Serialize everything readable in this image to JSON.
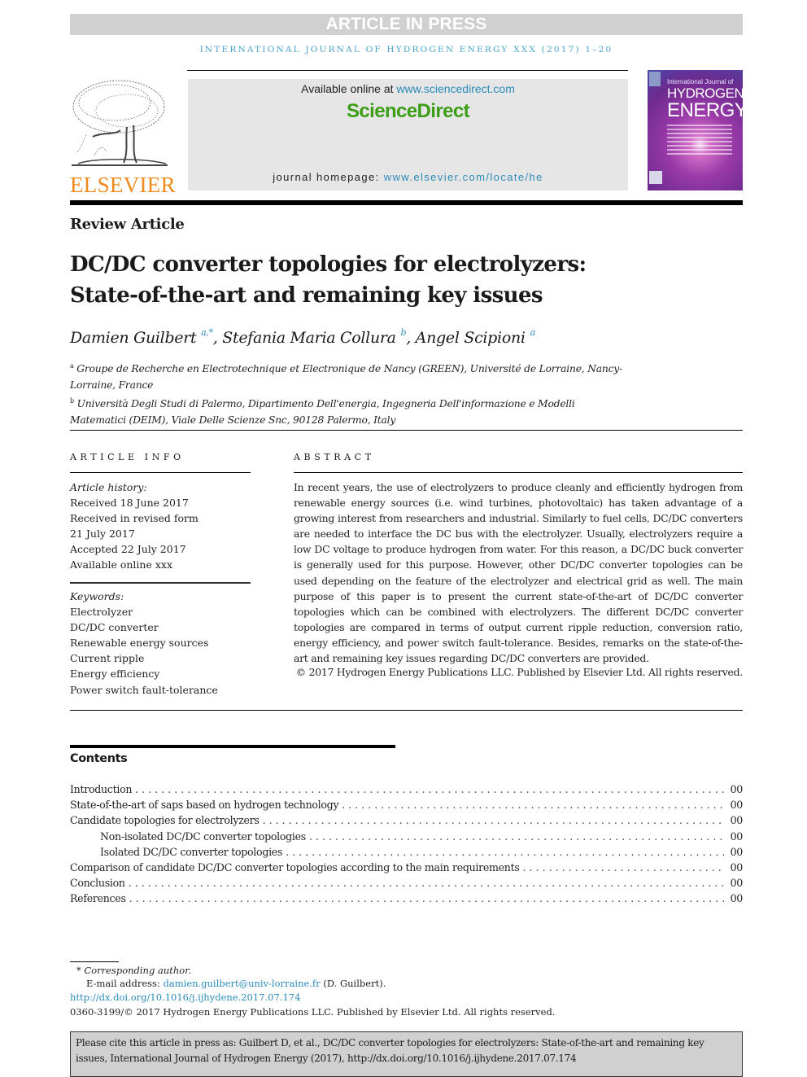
{
  "banner": {
    "text": "ARTICLE IN PRESS"
  },
  "running_header": "INTERNATIONAL JOURNAL OF HYDROGEN ENERGY XXX (2017) 1–20",
  "masthead": {
    "publisher_logo_text": "ELSEVIER",
    "available_online_prefix": "Available online at ",
    "available_online_link": "www.sciencedirect.com",
    "platform_name": "ScienceDirect",
    "homepage_prefix": "journal homepage: ",
    "homepage_link": "www.elsevier.com/locate/he",
    "cover": {
      "line1": "International Journal of",
      "line2": "HYDROGEN",
      "line3": "ENERGY"
    },
    "colors": {
      "elsevier_orange": "#f08a1e",
      "sciencedirect_green": "#3c9d17",
      "link_blue": "#2a8ab8"
    }
  },
  "article": {
    "type": "Review Article",
    "title_line1": "DC/DC converter topologies for electrolyzers:",
    "title_line2": "State-of-the-art and remaining key issues",
    "authors": [
      {
        "name": "Damien Guilbert",
        "sup": "a,*"
      },
      {
        "name": "Stefania Maria Collura",
        "sup": "b"
      },
      {
        "name": "Angel Scipioni",
        "sup": "a"
      }
    ],
    "author_separator": ", ",
    "affiliations": [
      {
        "mark": "a",
        "text": "Groupe de Recherche en Electrotechnique et Electronique de Nancy (GREEN), Université de Lorraine, Nancy-Lorraine, France"
      },
      {
        "mark": "b",
        "text": "Università Degli Studi di Palermo, Dipartimento Dell'energia, Ingegneria Dell'informazione e Modelli Matematici (DEIM), Viale Delle Scienze Snc, 90128 Palermo, Italy"
      }
    ]
  },
  "article_info": {
    "caption": "ARTICLE INFO",
    "history_label": "Article history:",
    "history": [
      "Received 18 June 2017",
      "Received in revised form",
      "21 July 2017",
      "Accepted 22 July 2017",
      "Available online xxx"
    ],
    "keywords_label": "Keywords:",
    "keywords": [
      "Electrolyzer",
      "DC/DC converter",
      "Renewable energy sources",
      "Current ripple",
      "Energy efficiency",
      "Power switch fault-tolerance"
    ]
  },
  "abstract": {
    "caption": "ABSTRACT",
    "text": "In recent years, the use of electrolyzers to produce cleanly and efficiently hydrogen from renewable energy sources (i.e. wind turbines, photovoltaic) has taken advantage of a growing interest from researchers and industrial. Similarly to fuel cells, DC/DC converters are needed to interface the DC bus with the electrolyzer. Usually, electrolyzers require a low DC voltage to produce hydrogen from water. For this reason, a DC/DC buck converter is generally used for this purpose. However, other DC/DC converter topologies can be used depending on the feature of the electrolyzer and electrical grid as well. The main purpose of this paper is to present the current state-of-the-art of DC/DC converter topologies which can be combined with electrolyzers. The different DC/DC converter topologies are compared in terms of output current ripple reduction, conversion ratio, energy efficiency, and power switch fault-tolerance. Besides, remarks on the state-of-the-art and remaining key issues regarding DC/DC converters are provided.",
    "copyright": "© 2017 Hydrogen Energy Publications LLC. Published by Elsevier Ltd. All rights reserved."
  },
  "contents": {
    "title": "Contents",
    "entries": [
      {
        "label": "Introduction",
        "page": "00",
        "level": 1
      },
      {
        "label": "State-of-the-art of saps based on hydrogen technology",
        "page": "00",
        "level": 1
      },
      {
        "label": "Candidate topologies for electrolyzers",
        "page": "00",
        "level": 1
      },
      {
        "label": "Non-isolated DC/DC converter topologies",
        "page": "00",
        "level": 2
      },
      {
        "label": "Isolated DC/DC converter topologies",
        "page": "00",
        "level": 2
      },
      {
        "label": "Comparison of candidate DC/DC converter topologies according to the main requirements",
        "page": "00",
        "level": 1
      },
      {
        "label": "Conclusion",
        "page": "00",
        "level": 1
      },
      {
        "label": "References",
        "page": "00",
        "level": 1
      }
    ]
  },
  "footnotes": {
    "corresponding": "* Corresponding author.",
    "email_prefix": "E-mail address: ",
    "email": "damien.guilbert@univ-lorraine.fr",
    "email_suffix": " (D. Guilbert).",
    "doi": "http://dx.doi.org/10.1016/j.ijhydene.2017.07.174",
    "issn_line": "0360-3199/© 2017 Hydrogen Energy Publications LLC. Published by Elsevier Ltd. All rights reserved."
  },
  "citation": {
    "text": "Please cite this article in press as: Guilbert D, et al., DC/DC converter topologies for electrolyzers: State-of-the-art and remaining key issues, International Journal of Hydrogen Energy (2017), http://dx.doi.org/10.1016/j.ijhydene.2017.07.174"
  }
}
